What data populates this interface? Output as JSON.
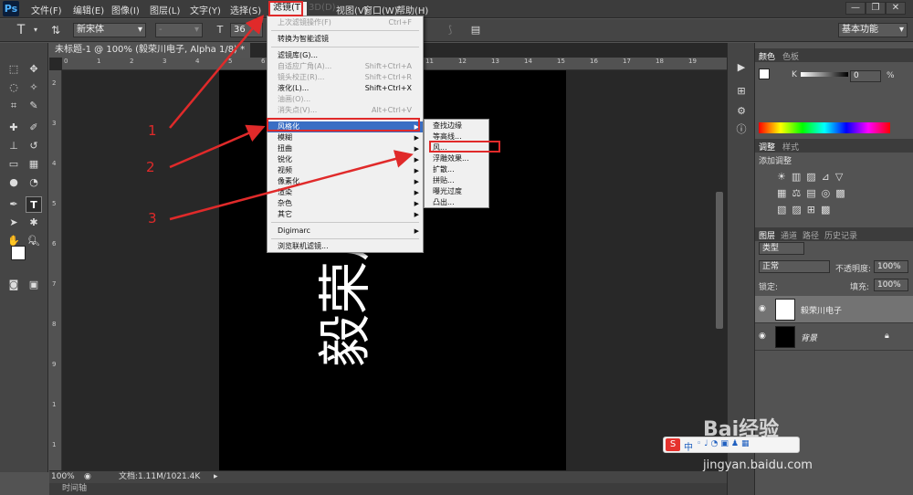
{
  "app": {
    "logo": "Ps",
    "accent": "#3a6ec4",
    "annotation_color": "#e02a2a"
  },
  "menubar": {
    "items": [
      "文件(F)",
      "编辑(E)",
      "图像(I)",
      "图层(L)",
      "文字(Y)",
      "选择(S)",
      "滤镜(T)",
      "3D(D)",
      "视图(V)",
      "窗口(W)",
      "帮助(H)"
    ],
    "window_buttons": [
      "—",
      "❐",
      "✕"
    ]
  },
  "optionsbar": {
    "font_family": "新宋体",
    "font_style": "-",
    "font_size": "36",
    "workspace": "基本功能"
  },
  "document": {
    "tab_title": "未标题-1 @ 100% (毅荣川电子, Alpha 1/8) *",
    "canvas_text": "毅荣川",
    "zoom": "100%",
    "doc_size": "文档:1.11M/1021.4K",
    "timeline_label": "时间轴",
    "ruler_top": [
      "0",
      "1",
      "2",
      "3",
      "4",
      "5",
      "6",
      "7",
      "8",
      "9",
      "10",
      "11",
      "12",
      "13",
      "14",
      "15",
      "16",
      "17",
      "18",
      "19"
    ],
    "ruler_left": [
      "2",
      "3",
      "4",
      "5",
      "6",
      "7",
      "8",
      "9",
      "1",
      "1"
    ]
  },
  "filter_menu": {
    "items": [
      {
        "label": "上次滤镜操作(F)",
        "shortcut": "Ctrl+F",
        "disabled": true
      },
      {
        "label": "转换为智能滤镜",
        "shortcut": "",
        "disabled": false
      },
      {
        "label": "滤镜库(G)...",
        "shortcut": "",
        "disabled": false
      },
      {
        "label": "自适应广角(A)...",
        "shortcut": "Shift+Ctrl+A",
        "disabled": true
      },
      {
        "label": "镜头校正(R)...",
        "shortcut": "Shift+Ctrl+R",
        "disabled": true
      },
      {
        "label": "液化(L)...",
        "shortcut": "Shift+Ctrl+X",
        "disabled": false
      },
      {
        "label": "油画(O)...",
        "shortcut": "",
        "disabled": true
      },
      {
        "label": "消失点(V)...",
        "shortcut": "Alt+Ctrl+V",
        "disabled": true
      },
      {
        "label": "风格化",
        "shortcut": "",
        "disabled": false
      },
      {
        "label": "模糊",
        "shortcut": "",
        "disabled": false
      },
      {
        "label": "扭曲",
        "shortcut": "",
        "disabled": false
      },
      {
        "label": "锐化",
        "shortcut": "",
        "disabled": false
      },
      {
        "label": "视频",
        "shortcut": "",
        "disabled": false
      },
      {
        "label": "像素化",
        "shortcut": "",
        "disabled": false
      },
      {
        "label": "渲染",
        "shortcut": "",
        "disabled": false
      },
      {
        "label": "杂色",
        "shortcut": "",
        "disabled": false
      },
      {
        "label": "其它",
        "shortcut": "",
        "disabled": false
      },
      {
        "label": "Digimarc",
        "shortcut": "",
        "disabled": false
      },
      {
        "label": "浏览联机滤镜...",
        "shortcut": "",
        "disabled": false
      }
    ]
  },
  "stylize_submenu": {
    "items": [
      "查找边缘",
      "等高线...",
      "风...",
      "浮雕效果...",
      "扩散...",
      "拼贴...",
      "曝光过度",
      "凸出..."
    ]
  },
  "annotations": [
    "1",
    "2",
    "3"
  ],
  "panels": {
    "color_tabs": [
      "颜色",
      "色板"
    ],
    "k_label": "K",
    "k_value": "0",
    "k_unit": "%",
    "adjust_tabs": [
      "调整",
      "样式"
    ],
    "adjust_title": "添加调整",
    "layer_tabs": [
      "图层",
      "通道",
      "路径",
      "历史记录"
    ],
    "layer_filter": "类型",
    "blend_mode": "正常",
    "opacity_label": "不透明度:",
    "opacity_value": "100%",
    "lock_label": "锁定:",
    "fill_label": "填充:",
    "fill_value": "100%",
    "layers": [
      {
        "name": "毅荣川电子",
        "selected": true
      },
      {
        "name": "背景",
        "selected": false
      }
    ]
  },
  "watermark": {
    "text": "Bai经验",
    "url": "jingyan.baidu.com",
    "ime": "中"
  }
}
